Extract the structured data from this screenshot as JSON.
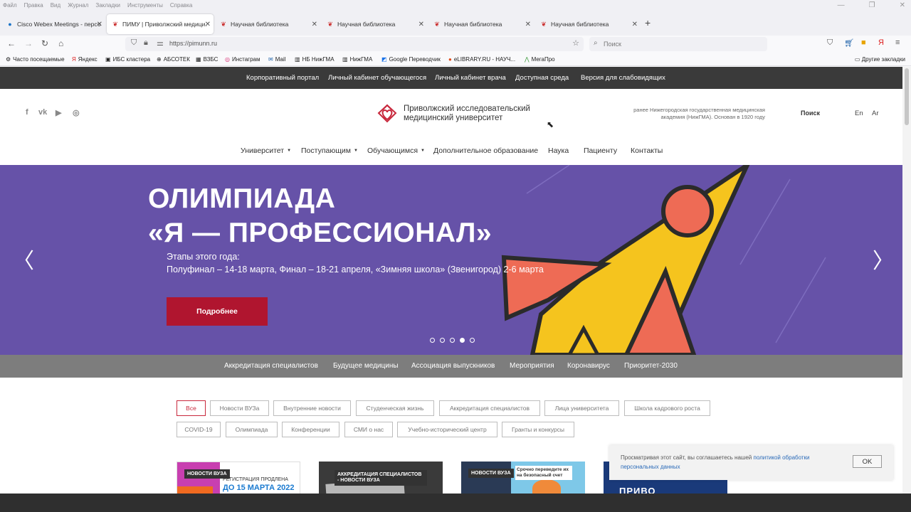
{
  "menubar": [
    "Файл",
    "Правка",
    "Вид",
    "Журнал",
    "Закладки",
    "Инструменты",
    "Справка"
  ],
  "tabs": [
    {
      "label": "Cisco Webex Meetings - персо...",
      "active": false
    },
    {
      "label": "ПИМУ | Приволжский медици...",
      "active": true
    },
    {
      "label": "Научная библиотека",
      "active": false
    },
    {
      "label": "Научная библиотека",
      "active": false
    },
    {
      "label": "Научная библиотека",
      "active": false
    },
    {
      "label": "Научная библиотека",
      "active": false
    }
  ],
  "address": {
    "url": "https://pimunn.ru",
    "search_placeholder": "Поиск"
  },
  "bookmarks": [
    "Часто посещаемые",
    "Яндекс",
    "ИБС кластера",
    "АБСОТЕК",
    "ВЗБС",
    "Инстаграм",
    "Mail",
    "НБ НижГМА",
    "НижГМА",
    "Google Переводчик",
    "eLIBRARY.RU - НАУЧ...",
    "МегаПро"
  ],
  "bookmarks_other": "Другие закладки",
  "topbar": [
    "Корпоративный портал",
    "Личный кабинет обучающегося",
    "Личный кабинет врача",
    "Доступная среда",
    "Версия для слабовидящих"
  ],
  "social": [
    "f",
    "vk",
    "▶",
    "◎"
  ],
  "logo": {
    "line1": "Приволжский исследовательский",
    "line2": "медицинский университет"
  },
  "former": {
    "line1": "ранее Нижегородская государственная медицинская",
    "line2": "академия (НижГМА). Основан в 1920 году"
  },
  "header_search": "Поиск",
  "languages": [
    "En",
    "Ar"
  ],
  "mainnav": [
    {
      "label": "Университет",
      "dropdown": true
    },
    {
      "label": "Поступающим",
      "dropdown": true
    },
    {
      "label": "Обучающимся",
      "dropdown": true
    },
    {
      "label": "Дополнительное образование",
      "dropdown": false
    },
    {
      "label": "Наука",
      "dropdown": false
    },
    {
      "label": "Пациенту",
      "dropdown": false
    },
    {
      "label": "Контакты",
      "dropdown": false
    }
  ],
  "banner": {
    "title1": "ОЛИМПИАДА",
    "title2": "«Я — ПРОФЕССИОНАЛ»",
    "sub1": "Этапы этого года:",
    "sub2": "Полуфинал – 14-18 марта, Финал – 18-21 апреля, «Зимняя школа» (Звенигород) 2-6 марта",
    "button": "Подробнее",
    "slides_total": 5,
    "active_slide": 4,
    "bg_color": "#6652a8"
  },
  "greybar": [
    "Аккредитация специалистов",
    "Будущее медицины",
    "Ассоциация выпускников",
    "Мероприятия",
    "Коронавирус",
    "Приоритет-2030"
  ],
  "filters_row1": [
    "Все",
    "Новости ВУЗа",
    "Внутренние новости",
    "Студенческая жизнь",
    "Аккредитация специалистов",
    "Лица университета",
    "Школа кадрового роста"
  ],
  "filters_row2": [
    "COVID-19",
    "Олимпиада",
    "Конференции",
    "СМИ о нас",
    "Учебно-исторический центр",
    "Гранты и конкурсы"
  ],
  "cards": [
    {
      "tag": "НОВОСТИ ВУЗА",
      "text1": "РЕГИСТРАЦИЯ ПРОДЛЕНА",
      "text2": "ДО 15 МАРТА 2022"
    },
    {
      "tag": "АККРЕДИТАЦИЯ СПЕЦИАЛИСТОВ - НОВОСТИ ВУЗА",
      "text1": "",
      "text2": ""
    },
    {
      "tag": "НОВОСТИ ВУЗА",
      "text1": "Срочно переведите их на безопасный счет",
      "text2": ""
    },
    {
      "tag": "",
      "text1": "ПРИВО",
      "text2": ""
    }
  ],
  "cookie": {
    "text": "Просматривая этот сайт, вы соглашаетесь нашей",
    "link": "политикой обработки персональных данных",
    "ok": "OK"
  },
  "colors": {
    "accent_red": "#b0152f",
    "filter_active": "#c8283c",
    "topbar": "#3a3a3a",
    "greybar": "#7d7d7d"
  }
}
